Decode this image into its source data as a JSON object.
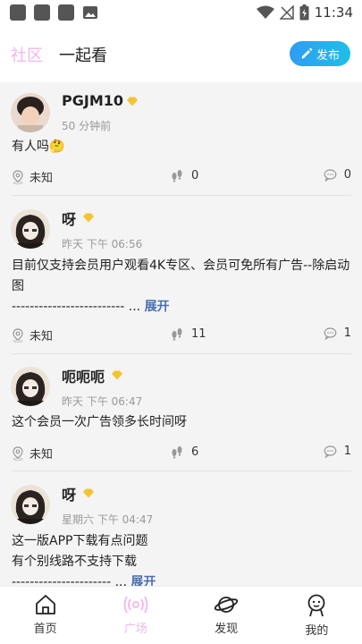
{
  "status_bar": {
    "time": "11:34"
  },
  "header": {
    "tab_community": "社区",
    "tab_watch": "一起看",
    "publish_label": "发布"
  },
  "posts": [
    {
      "username": "PGJM10",
      "time": "50 分钟前",
      "text": "有人吗🤔",
      "location": "未知",
      "views": "0",
      "comments": "0"
    },
    {
      "username": "呀",
      "time": "昨天 下午 06:56",
      "text": "目前仅支持会员用户观看4K专区、会员可免所有广告--除启动图",
      "text2": "------------------------- ...",
      "expand": "展开",
      "location": "未知",
      "views": "11",
      "comments": "1"
    },
    {
      "username": "呃呃呃",
      "time": "昨天 下午 06:47",
      "text": "这个会员一次广告领多长时间呀",
      "location": "未知",
      "views": "6",
      "comments": "1"
    },
    {
      "username": "呀",
      "time": "星期六 下午 04:47",
      "text": "这一版APP下载有点问题",
      "text2": "有个别线路不支持下载",
      "text3": "---------------------- ...",
      "expand": "展开"
    }
  ],
  "bottom_nav": [
    {
      "label": "首页",
      "icon": "home-icon"
    },
    {
      "label": "广场",
      "icon": "broadcast-icon",
      "active": true
    },
    {
      "label": "发现",
      "icon": "planet-icon"
    },
    {
      "label": "我的",
      "icon": "profile-icon"
    }
  ],
  "colors": {
    "accent_pink": "#f0b6ee",
    "publish_blue": "#2f9cf3",
    "link_blue": "#4a6fb0",
    "vip_gold": "#f3c431"
  }
}
